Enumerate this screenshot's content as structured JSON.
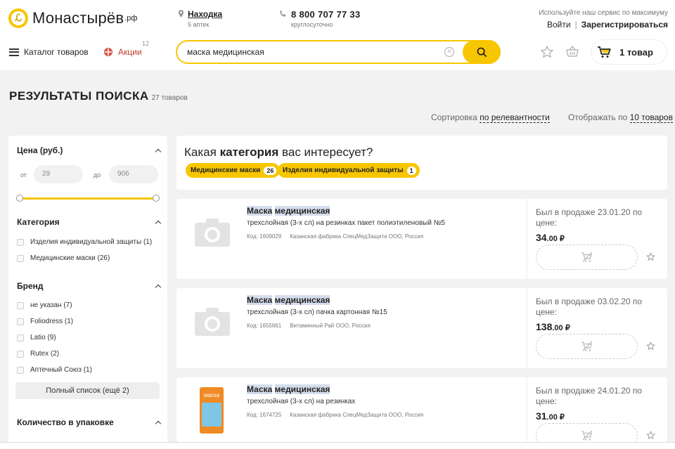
{
  "header": {
    "logo_text": "Монастырёв",
    "logo_suffix": ".рф",
    "city": "Находка",
    "city_sub": "5 аптек",
    "phone": "8 800 707 77 33",
    "phone_sub": "круглосуточно",
    "promo": "Используйте наш сервис по максимуму",
    "login": "Войти",
    "separator": "|",
    "register": "Зарегистрироваться",
    "catalog": "Каталог товаров",
    "actions": "Акции",
    "actions_count": "12",
    "search_value": "маска медицинская",
    "cart": "1 товар"
  },
  "results": {
    "title": "РЕЗУЛЬТАТЫ ПОИСКА",
    "count": "27 товаров",
    "sort_label": "Сортировка",
    "sort_value": "по релевантности",
    "display_label": "Отображать по",
    "display_value": "10 товаров"
  },
  "filters": {
    "price_title": "Цена (руб.)",
    "from_label": "от",
    "from_value": "29",
    "to_label": "до",
    "to_value": "906",
    "category_title": "Категория",
    "categories": [
      "Изделия индивидуальной защиты (1)",
      "Медицинские маски (26)"
    ],
    "brand_title": "Бренд",
    "brands": [
      "не указан (7)",
      "Foliodress (1)",
      "Latio (9)",
      "Rutex (2)",
      "Аптечный Союз (1)"
    ],
    "full_list": "Полный список (ещё 2)",
    "qty_title": "Количество в упаковке"
  },
  "category_prompt": {
    "q1": "Какая ",
    "q2": "категория",
    "q3": " вас интересует?",
    "chips": [
      {
        "label": "Медицинские маски",
        "count": "26"
      },
      {
        "label": "Изделия индивидуальной защиты",
        "count": "1"
      }
    ]
  },
  "products": [
    {
      "name1": "Маска",
      "name2": "медицинская",
      "desc": "трехслойная (3-х сл) на резинках пакет полиэтиленовый №5",
      "code": "Код: 1609029",
      "maker": "Казанская фабрика СпецМедЗащита ООО, Россия",
      "sold": "Был в продаже 23.01.20 по цене:",
      "price": "34",
      "cents": ".00 ₽"
    },
    {
      "name1": "Маска",
      "name2": "медицинская",
      "desc": "трехслойная (3-х сл) пачка картонная №15",
      "code": "Код: 1655661",
      "maker": "Витаминный Рай ООО, Россия",
      "sold": "Был в продаже 03.02.20 по цене:",
      "price": "138",
      "cents": ".00 ₽"
    },
    {
      "name1": "Маска",
      "name2": "медицинская",
      "desc": "трехслойная (3-х сл) на резинках",
      "code": "Код: 1674725",
      "maker": "Казанская фабрика СпецМедЗащита ООО, Россия",
      "sold": "Был в продаже 24.01.20 по цене:",
      "price": "31",
      "cents": ".00 ₽",
      "image_label": "маска"
    }
  ],
  "colors": {
    "accent": "#f7c600",
    "sale": "#c0392b",
    "highlight": "#d4ddeb"
  }
}
